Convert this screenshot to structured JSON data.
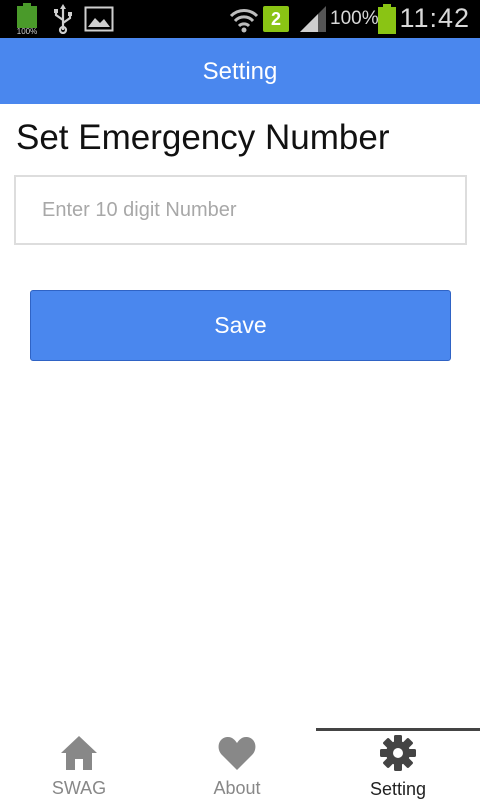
{
  "status_bar": {
    "battery_small_label": "100%",
    "sim_slot": "2",
    "battery_percent": "100%",
    "time": "11:42",
    "icons": [
      "battery-icon",
      "usb-icon",
      "image-icon",
      "wifi-icon",
      "sim-icon",
      "signal-icon",
      "battery-icon"
    ]
  },
  "app_bar": {
    "title": "Setting"
  },
  "main": {
    "heading": "Set Emergency Number",
    "number_input": {
      "value": "",
      "placeholder": "Enter 10 digit Number"
    },
    "save_label": "Save"
  },
  "tabs": [
    {
      "label": "SWAG",
      "icon": "home-icon",
      "active": false
    },
    {
      "label": "About",
      "icon": "heart-icon",
      "active": false
    },
    {
      "label": "Setting",
      "icon": "gear-icon",
      "active": true
    }
  ],
  "colors": {
    "primary": "#4a87ee",
    "status_bar": "#000000",
    "battery_green": "#8ac414",
    "inactive_tab": "#888888"
  }
}
